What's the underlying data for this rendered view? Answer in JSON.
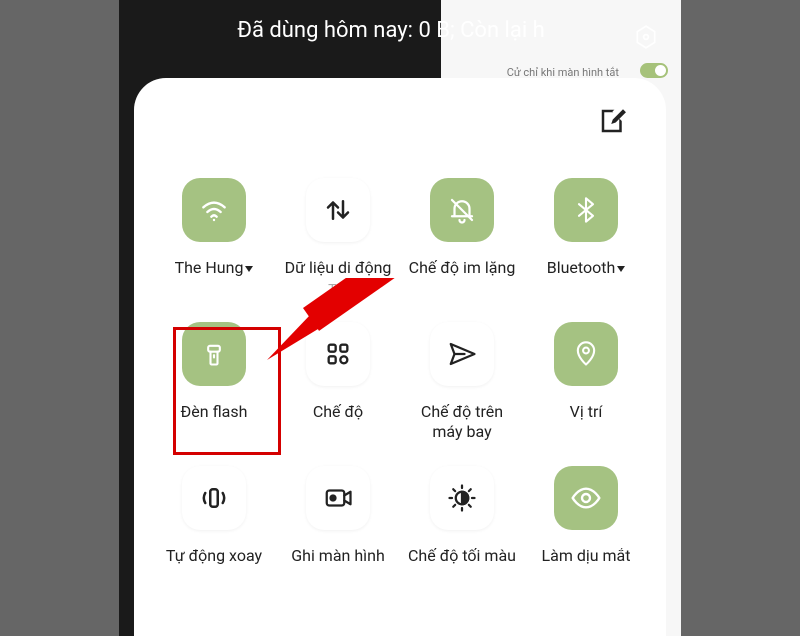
{
  "status": {
    "text": "Đã dùng hôm nay: 0 B; Còn lại h"
  },
  "bg": {
    "gesture_off": "Cử chỉ khi màn hình tắt"
  },
  "tiles": [
    {
      "label": "The Hung",
      "hasCaret": true
    },
    {
      "label": "Dữ liệu di động",
      "sub": "Tắt"
    },
    {
      "label": "Chế độ im lặng"
    },
    {
      "label": "Bluetooth",
      "hasCaret": true
    },
    {
      "label": "Đèn flash"
    },
    {
      "label": "Chế độ"
    },
    {
      "label": "Chế độ trên máy bay"
    },
    {
      "label": "Vị trí"
    },
    {
      "label": "Tự động xoay"
    },
    {
      "label": "Ghi màn hình"
    },
    {
      "label": "Chế độ tối màu"
    },
    {
      "label": "Làm dịu mắt"
    }
  ]
}
